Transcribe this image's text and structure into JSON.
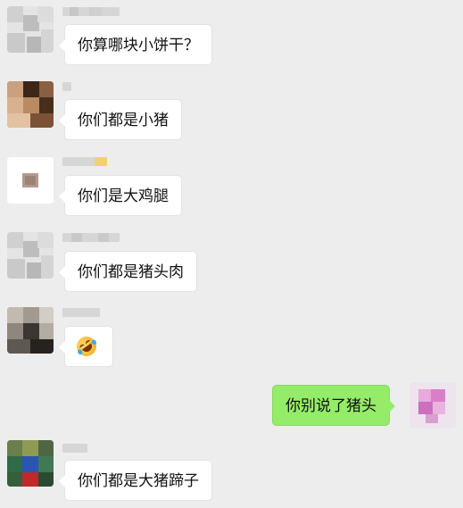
{
  "chat": {
    "messages": [
      {
        "side": "left",
        "text": "你算哪块小饼干？"
      },
      {
        "side": "left",
        "text": "你们都是小猪"
      },
      {
        "side": "left",
        "text": "你们是大鸡腿"
      },
      {
        "side": "left",
        "text": "你们都是猪头肉"
      },
      {
        "side": "left",
        "emoji": "rolling-on-floor-laughing-emoji"
      },
      {
        "side": "right",
        "text": "你别说了猪头"
      },
      {
        "side": "left",
        "text": "你们都是大猪蹄子"
      }
    ]
  },
  "colors": {
    "background": "#ededed",
    "incoming_bubble": "#ffffff",
    "outgoing_bubble": "#95ec69"
  }
}
